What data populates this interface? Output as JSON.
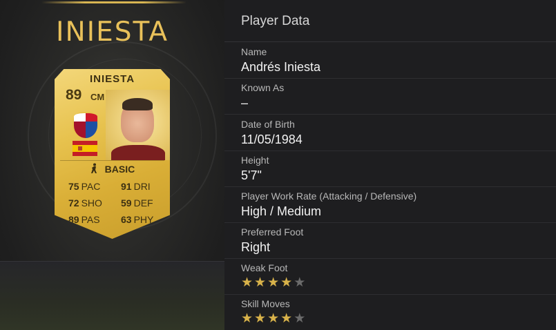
{
  "card": {
    "title": "INIESTA",
    "name": "INIESTA",
    "rating": "89",
    "position": "CM",
    "chemistry": "BASIC",
    "stats": [
      {
        "value": "75",
        "label": "PAC"
      },
      {
        "value": "91",
        "label": "DRI"
      },
      {
        "value": "72",
        "label": "SHO"
      },
      {
        "value": "59",
        "label": "DEF"
      },
      {
        "value": "89",
        "label": "PAS"
      },
      {
        "value": "63",
        "label": "PHY"
      }
    ]
  },
  "panel": {
    "title": "Player Data",
    "fields": [
      {
        "label": "Name",
        "value": "Andrés Iniesta"
      },
      {
        "label": "Known As",
        "value": "–"
      },
      {
        "label": "Date of Birth",
        "value": "11/05/1984"
      },
      {
        "label": "Height",
        "value": "5'7\""
      },
      {
        "label": "Player Work Rate (Attacking / Defensive)",
        "value": "High / Medium"
      },
      {
        "label": "Preferred Foot",
        "value": "Right"
      },
      {
        "label": "Weak Foot",
        "stars_filled": 4,
        "stars_total": 5
      },
      {
        "label": "Skill Moves",
        "stars_filled": 4,
        "stars_total": 5
      }
    ]
  },
  "colors": {
    "accent": "#e9c15a",
    "star_on": "#d8b24a",
    "star_off": "#6b6b6b"
  },
  "icons": {
    "chemistry": "player-silhouette-icon",
    "star": "star-icon"
  }
}
